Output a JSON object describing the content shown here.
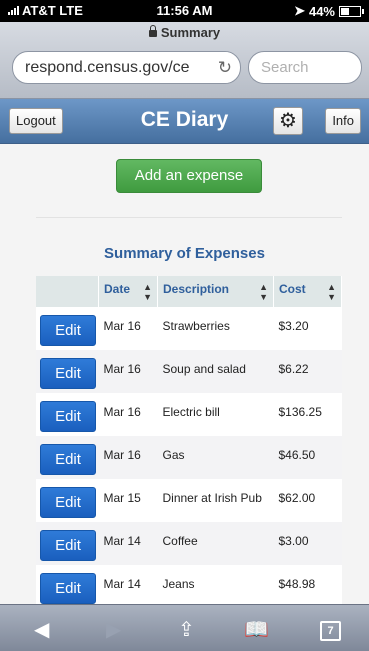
{
  "status": {
    "carrier": "AT&T LTE",
    "time": "11:56 AM",
    "battery": "44%",
    "battery_level": 0.44
  },
  "browser": {
    "page_title": "Summary",
    "url": "respond.census.gov/ce",
    "search_placeholder": "Search",
    "tab_count": "7"
  },
  "header": {
    "title": "CE Diary",
    "logout_label": "Logout",
    "info_label": "Info"
  },
  "main": {
    "add_button_label": "Add an expense",
    "summary_title": "Summary of Expenses",
    "edit_label": "Edit",
    "columns": [
      "Date",
      "Description",
      "Cost"
    ],
    "rows": [
      {
        "date": "Mar 16",
        "description": "Strawberries",
        "cost": "$3.20"
      },
      {
        "date": "Mar 16",
        "description": "Soup and salad",
        "cost": "$6.22"
      },
      {
        "date": "Mar 16",
        "description": "Electric bill",
        "cost": "$136.25"
      },
      {
        "date": "Mar 16",
        "description": "Gas",
        "cost": "$46.50"
      },
      {
        "date": "Mar 15",
        "description": "Dinner at Irish Pub",
        "cost": "$62.00"
      },
      {
        "date": "Mar 14",
        "description": "Coffee",
        "cost": "$3.00"
      },
      {
        "date": "Mar 14",
        "description": "Jeans",
        "cost": "$48.98"
      }
    ]
  }
}
